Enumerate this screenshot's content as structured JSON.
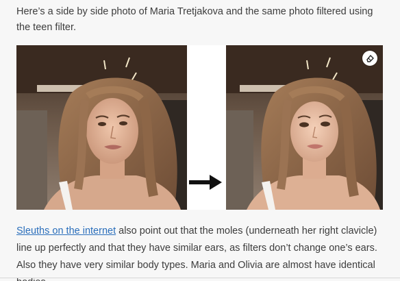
{
  "article": {
    "intro_text": "Here’s a side by side photo of Maria Tretjakova and the same photo filtered using the teen filter.",
    "link_text": "Sleuths on the internet",
    "body_text": " also point out that the moles (underneath her right clavicle) line up perfectly and that they have similar ears, as filters don’t change one’s ears. Also they have very similar body types. Maria and Olivia are almost have identical bodies."
  },
  "figure": {
    "left_photo": "original-photo",
    "right_photo": "teen-filtered-photo",
    "arrow_icon": "arrow-right-icon",
    "overlay_icon": "eraser-icon"
  },
  "colors": {
    "page_bg": "#f7f7f7",
    "text": "#3c3c3c",
    "link": "#2a6ebb",
    "hair": "#8a6447",
    "skin": "#e2b59a",
    "ceiling": "#5a4536"
  }
}
